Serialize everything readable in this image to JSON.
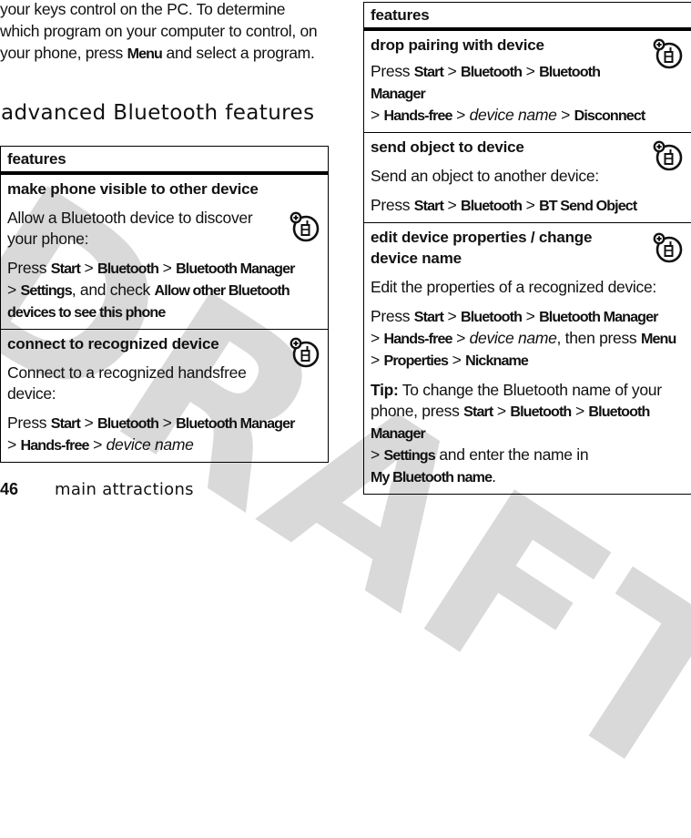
{
  "watermark": "DRAFT",
  "intro": {
    "line1": "your keys control on the PC. To determine which program on your computer to control, on your phone, press ",
    "menu_key": "Menu",
    "line2": " and select a program."
  },
  "section_title": "advanced Bluetooth features",
  "left_table": {
    "header": "features",
    "rows": [
      {
        "title": "make phone visible to other device",
        "desc": "Allow a Bluetooth device to discover your phone:",
        "press": "Press",
        "path": [
          "Start",
          "Bluetooth",
          "Bluetooth Manager",
          "Settings"
        ],
        "mid": ", and check ",
        "option": "Allow other Bluetooth devices to see this phone",
        "icon": "phone-accessory-icon"
      },
      {
        "title": "connect to recognized device",
        "desc": "Connect to a recognized handsfree device:",
        "press": "Press",
        "path": [
          "Start",
          "Bluetooth",
          "Bluetooth Manager",
          "Hands-free"
        ],
        "italic_end": "device name",
        "icon": "phone-accessory-icon"
      }
    ]
  },
  "right_table": {
    "header": "features",
    "rows": [
      {
        "title": "drop pairing with device",
        "press": "Press",
        "path": [
          "Start",
          "Bluetooth",
          "Bluetooth Manager",
          "Hands-free"
        ],
        "italic": "device name",
        "end": "Disconnect",
        "icon": "phone-accessory-icon"
      },
      {
        "title": "send object to device",
        "desc": "Send an object to another device:",
        "press": "Press",
        "path": [
          "Start",
          "Bluetooth",
          "BT Send Object"
        ],
        "icon": "phone-accessory-icon"
      },
      {
        "title": "edit device properties / change device name",
        "desc": "Edit the properties of a recognized device:",
        "press": "Press",
        "path": [
          "Start",
          "Bluetooth",
          "Bluetooth Manager",
          "Hands-free"
        ],
        "italic": "device name",
        "then": ", then press ",
        "menu": "Menu",
        "path2": [
          "Properties",
          "Nickname"
        ],
        "tip_label": "Tip:",
        "tip_text": " To change the Bluetooth name of your phone, press ",
        "tip_path": [
          "Start",
          "Bluetooth",
          "Bluetooth Manager",
          "Settings"
        ],
        "tip_mid": " and enter the name in ",
        "tip_field": "My Bluetooth name",
        "tip_end": ".",
        "icon": "phone-accessory-icon"
      }
    ]
  },
  "sep": ">",
  "footer": {
    "page_number": "46",
    "section": "main attractions"
  }
}
